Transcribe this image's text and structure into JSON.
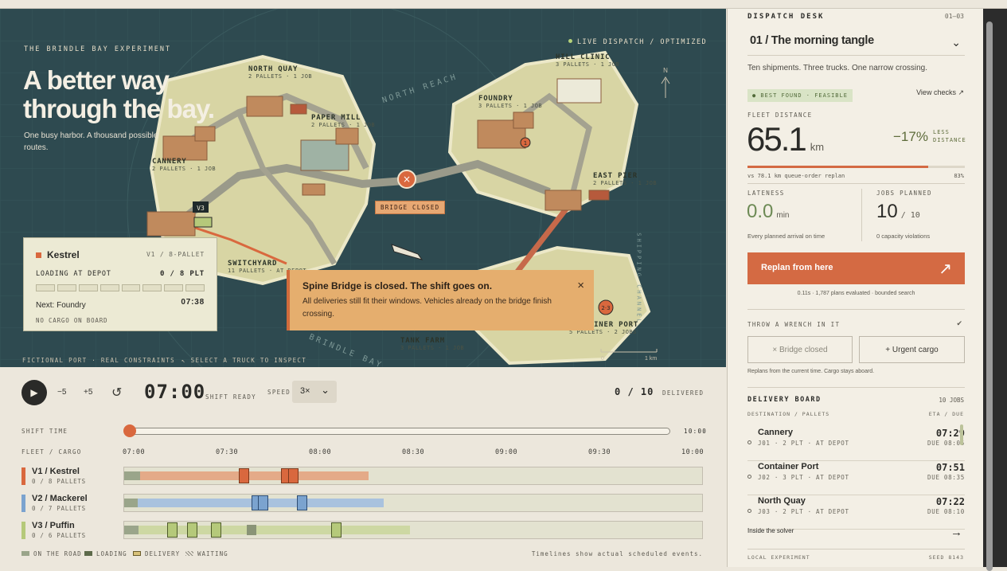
{
  "hero": {
    "kicker": "THE BRINDLE BAY EXPERIMENT",
    "title": "A better way through the bay.",
    "subtitle": "One busy harbor. A thousand possible routes.",
    "status_live": "LIVE DISPATCH",
    "status_sep": "/",
    "status_opt": "OPTIMIZED",
    "north": "N"
  },
  "map": {
    "places": [
      {
        "name": "NORTH QUAY",
        "sub": "2 PALLETS · 1 JOB"
      },
      {
        "name": "HILL CLINIC",
        "sub": "3 PALLETS · 1 JOB"
      },
      {
        "name": "FOUNDRY",
        "sub": "3 PALLETS · 1 JOB"
      },
      {
        "name": "PAPER MILL",
        "sub": "2 PALLETS · 1 JOB"
      },
      {
        "name": "CANNERY",
        "sub": "2 PALLETS · 1 JOB"
      },
      {
        "name": "EAST PIER",
        "sub": "2 PALLETS · 1 JOB"
      },
      {
        "name": "SWITCHYARD",
        "sub": "11 PALLETS · AT DEPOT"
      },
      {
        "name": "TANK FARM",
        "sub": "3 PALLETS · 1 JOB"
      },
      {
        "name": "CONTAINER PORT",
        "sub": "5 PALLETS · 2 JOBS"
      }
    ],
    "water_north": "NORTH REACH",
    "water_south": "BRINDLE BAY",
    "water_east": "SHIPPING CHANNEL",
    "bridge_label": "BRIDGE CLOSED",
    "truck_tag": "V3",
    "marker_1": "1",
    "marker_2": "2·3",
    "scale_0": "0",
    "scale_1": "1 km",
    "footer_left": "FICTIONAL PORT · REAL CONSTRAINTS",
    "footer_right": "↖ SELECT A TRUCK TO INSPECT"
  },
  "vehicle_card": {
    "name": "Kestrel",
    "meta": "V1 / 8-PALLET",
    "state": "LOADING AT DEPOT",
    "load": "0 / 8 PLT",
    "next_label": "Next: Foundry",
    "next_time": "07:38",
    "cargo": "NO CARGO ON BOARD",
    "segments": 8
  },
  "toast": {
    "title": "Spine Bridge is closed. The shift goes on.",
    "body": "All deliveries still fit their windows. Vehicles already on the bridge finish crossing.",
    "close": "×"
  },
  "controls": {
    "play": "▶",
    "back": "−5",
    "fwd": "+5",
    "reset": "↺",
    "clock": "07:00",
    "clock_state": "SHIFT READY",
    "speed_label": "SPEED",
    "speed": "3×",
    "speed_caret": "⌄",
    "delivered": "0 / 10",
    "delivered_label": "DELIVERED",
    "shift_time": "SHIFT TIME",
    "shift_end": "10:00",
    "fleet_label": "FLEET / CARGO",
    "ticks": [
      "07:00",
      "07:30",
      "08:00",
      "08:30",
      "09:00",
      "09:30",
      "10:00"
    ],
    "progress": 0
  },
  "fleet": [
    {
      "name": "V1 / Kestrel",
      "cargo": "0 / 8 PALLETS",
      "color": "#d9683e",
      "bar": "#e4aa88"
    },
    {
      "name": "V2 / Mackerel",
      "cargo": "0 / 7 PALLETS",
      "color": "#7ba3cf",
      "bar": "#a9c2de"
    },
    {
      "name": "V3 / Puffin",
      "cargo": "0 / 6 PALLETS",
      "color": "#b5c97a",
      "bar": "#cdd8a3"
    }
  ],
  "legend": {
    "road": "ON THE ROAD",
    "loading": "LOADING",
    "delivery": "DELIVERY",
    "waiting": "WAITING",
    "note": "Timelines show actual scheduled events."
  },
  "panel": {
    "title": "DISPATCH DESK",
    "range": "01—03",
    "scenario": "01 / The morning tangle",
    "caret": "⌄",
    "summary": "Ten shipments. Three trucks. One narrow crossing.",
    "tag": "● BEST FOUND · FEASIBLE",
    "view_checks": "View checks ↗",
    "distance_label": "FLEET DISTANCE",
    "distance": "65.1",
    "distance_unit": "km",
    "delta": "−17%",
    "delta_label_1": "LESS",
    "delta_label_2": "DISTANCE",
    "compare": "vs 78.1 km queue-order replan",
    "compare_pct": "83%",
    "compare_fraction": 0.83,
    "lateness_label": "LATENESS",
    "lateness": "0.0",
    "lateness_unit": "min",
    "lateness_note": "Every planned arrival on time",
    "jobs_label": "JOBS PLANNED",
    "jobs": "10",
    "jobs_total": "/ 10",
    "jobs_note": "0 capacity violations",
    "cta": "Replan from here",
    "cta_icon": "↗",
    "cta_note": "0.11s · 1,787 plans evaluated · bounded search",
    "wrench": "THROW A WRENCH IN IT",
    "wrench_icon": "✔",
    "btn_bridge": "× Bridge closed",
    "btn_urgent": "+ Urgent cargo",
    "wrench_note": "Replans from the current time. Cargo stays aboard.",
    "board": "DELIVERY BOARD",
    "board_count": "10 JOBS",
    "col_left": "DESTINATION / PALLETS",
    "col_right": "ETA / DUE",
    "jobs_list": [
      {
        "dest": "Cannery",
        "meta": "J01 · 2 PLT · AT DEPOT",
        "eta": "07:29",
        "due": "DUE 08:05"
      },
      {
        "dest": "Container Port",
        "meta": "J02 · 3 PLT · AT DEPOT",
        "eta": "07:51",
        "due": "DUE 08:35"
      },
      {
        "dest": "North Quay",
        "meta": "J03 · 2 PLT · AT DEPOT",
        "eta": "07:22",
        "due": "DUE 08:10"
      }
    ],
    "inside": "Inside the solver",
    "inside_arrow": "→",
    "local": "LOCAL EXPERIMENT",
    "seed": "SEED 8143"
  }
}
